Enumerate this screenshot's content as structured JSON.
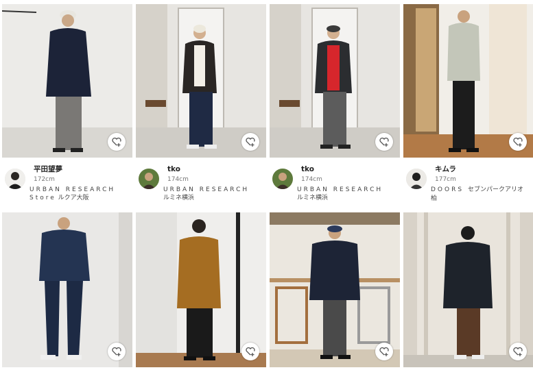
{
  "posts": [
    {
      "staff_name": "平田望夢",
      "height": "172cm",
      "brand": "URBAN RESEARCH",
      "store_line1": "Store",
      "store_line2": "ルクア大阪"
    },
    {
      "staff_name": "tko",
      "height": "174cm",
      "brand": "URBAN RESEARCH",
      "store_line1": "",
      "store_line2": "ルミネ横浜"
    },
    {
      "staff_name": "tko",
      "height": "174cm",
      "brand": "URBAN RESEARCH",
      "store_line1": "",
      "store_line2": "ルミネ横浜"
    },
    {
      "staff_name": "キムラ",
      "height": "177cm",
      "brand": "DOORS",
      "store_line1": "セブンパークアリオ",
      "store_line2": "柏"
    }
  ],
  "favorite_icon": "heart-plus-icon",
  "colors": {
    "background": "#ffffff",
    "text": "#222222",
    "subtext": "#777777"
  }
}
